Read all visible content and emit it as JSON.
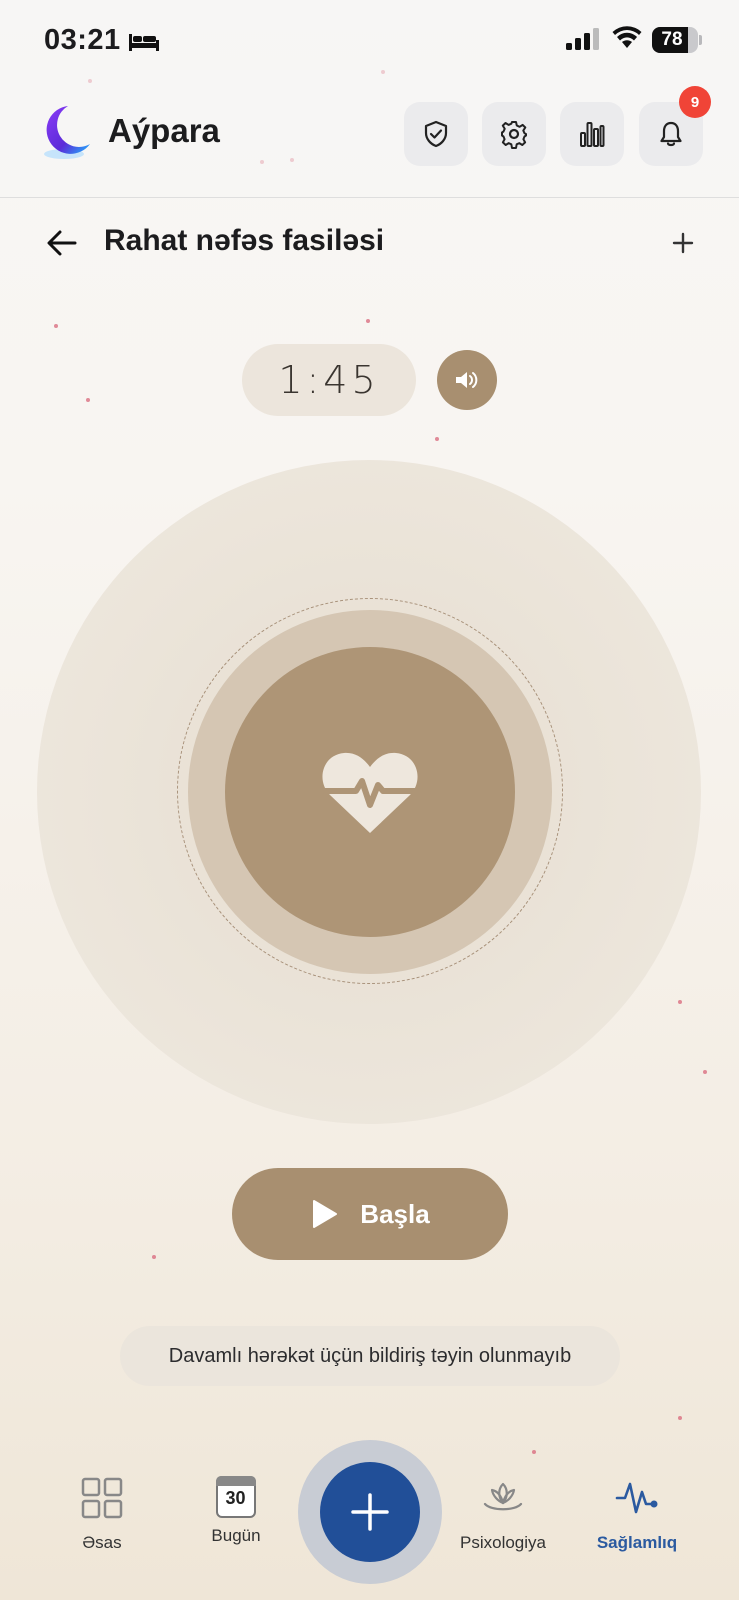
{
  "status_bar": {
    "time": "03:21",
    "battery": "78",
    "battery_level": 0.78
  },
  "app": {
    "title": "Aýpara",
    "notification_count": "9"
  },
  "page": {
    "title": "Rahat nəfəs fasiləsi"
  },
  "timer": {
    "value": "1:45"
  },
  "start_button": {
    "label": "Başla"
  },
  "notice": {
    "text": "Davamlı hərəkət üçün bildiriş təyin olunmayıb"
  },
  "nav": {
    "items": [
      {
        "label": "Əsas",
        "icon": "grid-icon"
      },
      {
        "label": "Bugün",
        "icon": "calendar-icon",
        "date": "30"
      },
      {
        "label": "Psixologiya",
        "icon": "lotus-icon"
      },
      {
        "label": "Sağlamlıq",
        "icon": "heartbeat-icon",
        "active": true
      }
    ]
  },
  "colors": {
    "accent": "#a88f70",
    "primary": "#214f98",
    "badge": "#f04437",
    "active_nav": "#2b5aa0"
  }
}
